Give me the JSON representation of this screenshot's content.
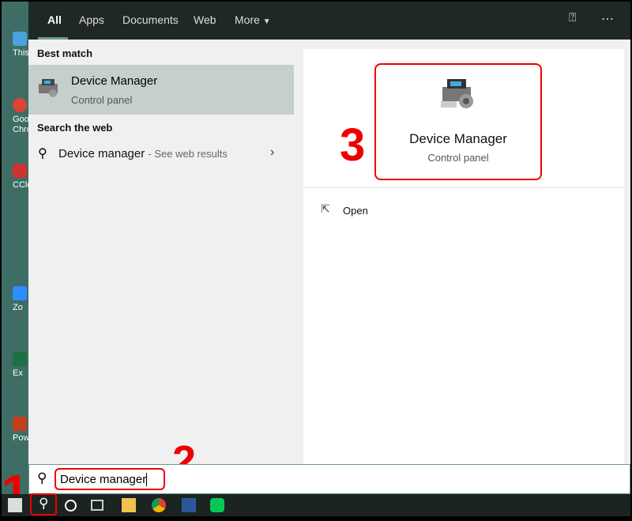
{
  "desktop": {
    "icons": [
      "This",
      "Goo Chro",
      "CCle",
      "Zo",
      "Ex",
      "Powe"
    ]
  },
  "tabs": [
    {
      "label": "All",
      "active": true
    },
    {
      "label": "Apps"
    },
    {
      "label": "Documents"
    },
    {
      "label": "Web"
    },
    {
      "label": "More"
    }
  ],
  "header_icons": [
    "feedback-icon",
    "more-options-icon"
  ],
  "left": {
    "best_match_heading": "Best match",
    "best_match": {
      "title": "Device Manager",
      "subtitle": "Control panel"
    },
    "web_heading": "Search the web",
    "web_result": {
      "query": "Device manager",
      "suffix": "- See web results"
    }
  },
  "preview": {
    "title": "Device Manager",
    "subtitle": "Control panel",
    "actions": [
      {
        "label": "Open"
      }
    ]
  },
  "search": {
    "value": "Device manager"
  },
  "annotations": [
    "1",
    "2",
    "3"
  ],
  "colors": {
    "accent": "#6f9a90",
    "annotation": "#e00000",
    "header": "#1f2826",
    "selected": "#c5d0cd"
  }
}
